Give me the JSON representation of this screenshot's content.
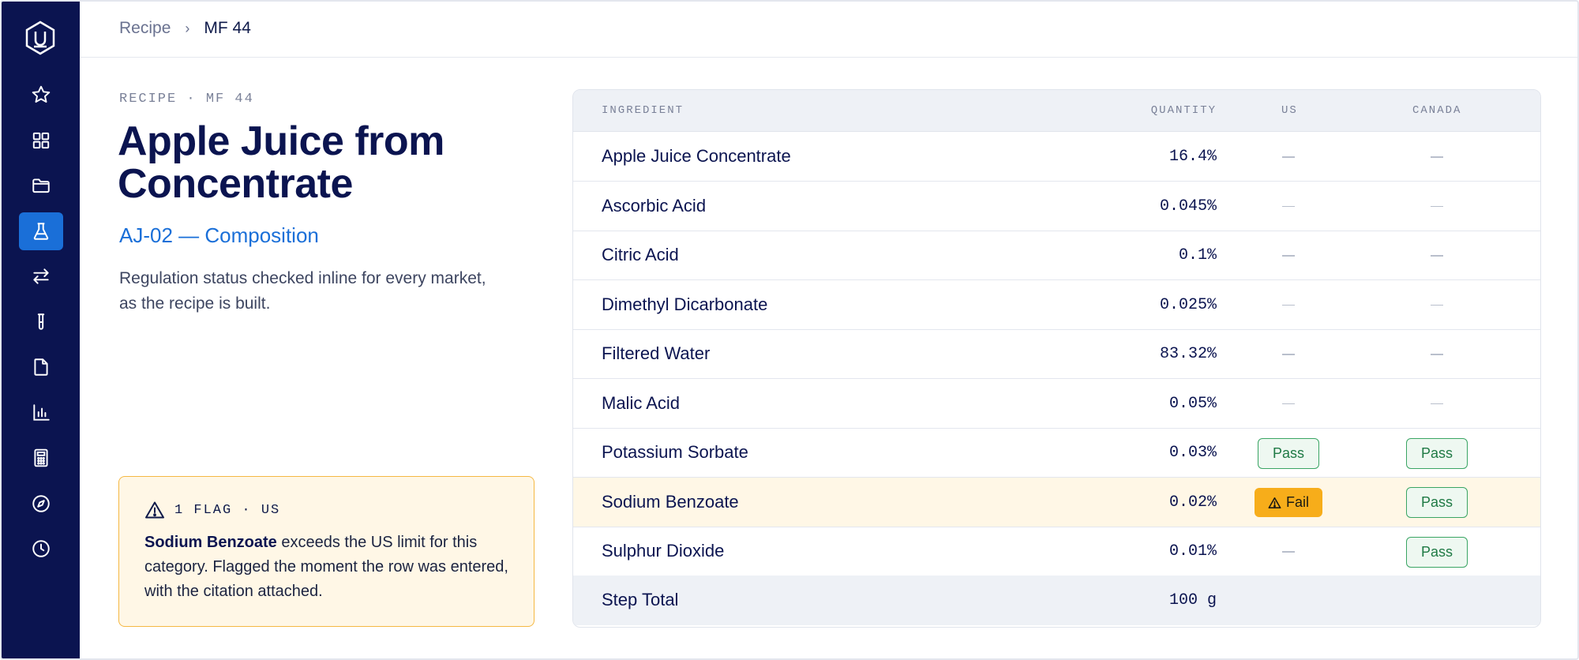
{
  "breadcrumb": {
    "parent": "Recipe",
    "separator": "›",
    "current": "MF 44"
  },
  "recipe": {
    "eyebrow": "RECIPE · MF 44",
    "title": "Apple Juice from Concentrate",
    "subtitle": "AJ-02 — Composition",
    "description": "Regulation status checked inline for every market, as the recipe is built."
  },
  "flag": {
    "header": "1 FLAG · US",
    "ingredient": "Sodium Benzoate",
    "message": " exceeds the US limit for this category. Flagged the moment the row was entered, with the citation attached."
  },
  "table": {
    "headers": {
      "ingredient": "INGREDIENT",
      "quantity": "QUANTITY",
      "us": "US",
      "canada": "CANADA"
    },
    "rows": [
      {
        "name": "Apple Juice Concentrate",
        "quantity": "16.4%",
        "us": "",
        "canada": ""
      },
      {
        "name": "Ascorbic Acid",
        "quantity": "0.045%",
        "us": "",
        "canada": ""
      },
      {
        "name": "Citric Acid",
        "quantity": "0.1%",
        "us": "",
        "canada": ""
      },
      {
        "name": "Dimethyl Dicarbonate",
        "quantity": "0.025%",
        "us": "",
        "canada": ""
      },
      {
        "name": "Filtered Water",
        "quantity": "83.32%",
        "us": "",
        "canada": ""
      },
      {
        "name": "Malic Acid",
        "quantity": "0.05%",
        "us": "",
        "canada": ""
      },
      {
        "name": "Potassium Sorbate",
        "quantity": "0.03%",
        "us": "Pass",
        "canada": "Pass"
      },
      {
        "name": "Sodium Benzoate",
        "quantity": "0.02%",
        "us": "Fail",
        "canada": "Pass"
      },
      {
        "name": "Sulphur Dioxide",
        "quantity": "0.01%",
        "us": "",
        "canada": "Pass"
      }
    ],
    "total": {
      "label": "Step Total",
      "quantity": "100 g"
    }
  },
  "sidebar": {
    "icons": [
      "star-icon",
      "grid-icon",
      "folder-icon",
      "flask-icon",
      "transfer-icon",
      "test-tube-icon",
      "document-icon",
      "chart-icon",
      "calculator-icon",
      "compass-icon",
      "clock-icon"
    ],
    "active": "flask-icon"
  },
  "colors": {
    "sidebar": "#0b1450",
    "accent": "#1a6fd8",
    "pass": "#3aa564",
    "fail": "#f7ad1a",
    "flag_bg": "#fff7e6"
  }
}
